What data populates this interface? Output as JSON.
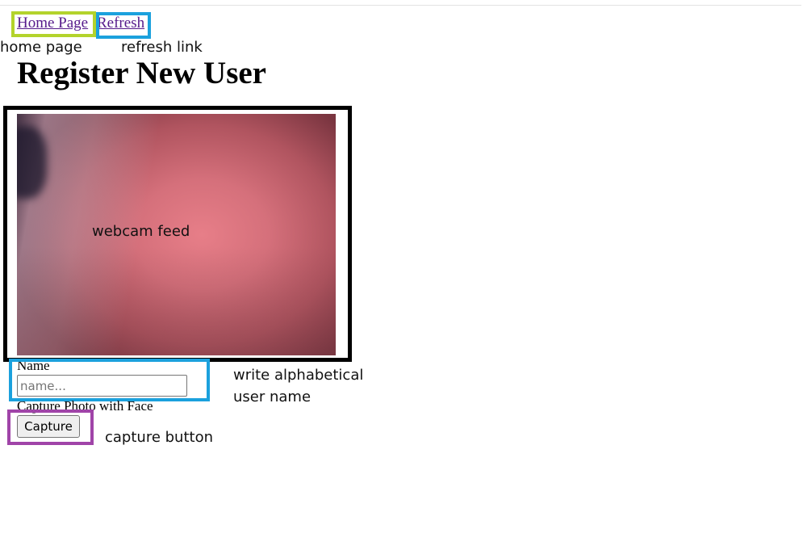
{
  "nav": {
    "home_label": "Home Page",
    "refresh_label": "Refresh"
  },
  "page": {
    "title": "Register New User"
  },
  "form": {
    "name_label": "Name",
    "name_value": "",
    "name_placeholder": "name...",
    "capture_label": "Capture Photo with Face",
    "capture_button": "Capture"
  },
  "annotations": {
    "home": "home page",
    "refresh": "refresh link",
    "webcam": "webcam feed",
    "name": "write alphabetical user name",
    "capture": "capture button"
  },
  "colors": {
    "link": "#551a8b",
    "box_home": "#b3d32c",
    "box_refresh": "#1ba1dd",
    "box_webcam": "#000000",
    "box_name": "#1ba1dd",
    "box_capture": "#a044a8"
  }
}
